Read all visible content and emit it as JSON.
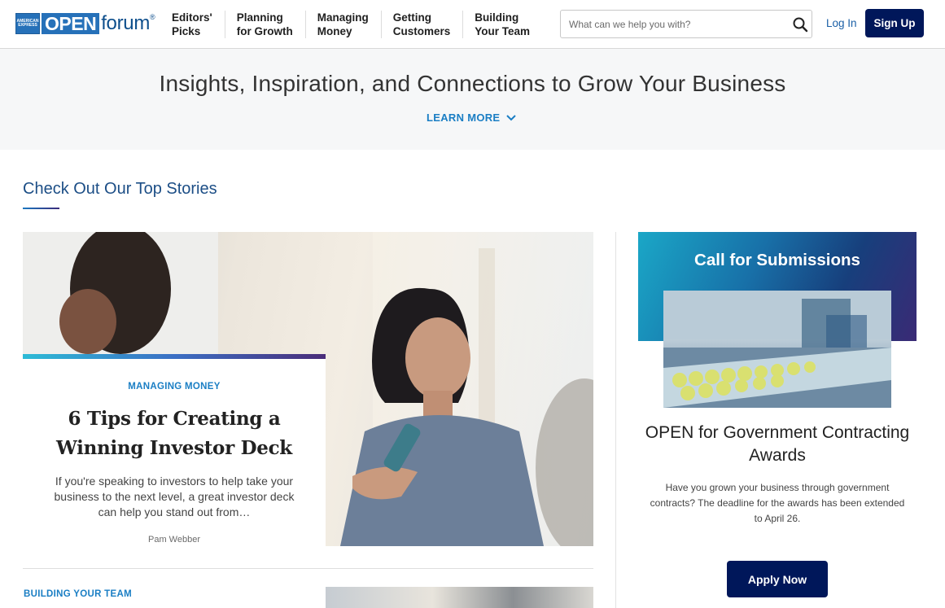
{
  "header": {
    "logo_mark_text": "AMERICAN EXPRESS",
    "logo_open": "OPEN",
    "logo_forum": "forum",
    "logo_reg": "®",
    "nav": [
      {
        "line1": "Editors'",
        "line2": "Picks"
      },
      {
        "line1": "Planning",
        "line2": "for Growth"
      },
      {
        "line1": "Managing",
        "line2": "Money"
      },
      {
        "line1": "Getting",
        "line2": "Customers"
      },
      {
        "line1": "Building",
        "line2": "Your Team"
      }
    ],
    "search_placeholder": "What can we help you with?",
    "search_icon": "search-icon",
    "login_label": "Log In",
    "signup_label": "Sign Up"
  },
  "hero": {
    "title": "Insights, Inspiration, and Connections to Grow Your Business",
    "learn_more": "LEARN MORE"
  },
  "top_stories": {
    "heading": "Check Out Our Top Stories",
    "featured": {
      "category": "MANAGING MONEY",
      "title": "6 Tips for Creating a Winning Investor Deck",
      "description": "If you're speaking to investors to help take your business to the next level, a great investor deck can help you stand out from…",
      "author": "Pam Webber"
    },
    "next": {
      "category": "BUILDING YOUR TEAM"
    }
  },
  "sidebar": {
    "promo_title": "Call for Submissions",
    "heading": "OPEN for Government Contracting Awards",
    "description": "Have you grown your business through government contracts? The deadline for the awards has been extended to April 26.",
    "button_label": "Apply Now"
  },
  "colors": {
    "brand_navy": "#00175a",
    "link_blue": "#1a7ec4",
    "heading_blue": "#1c4e86"
  }
}
